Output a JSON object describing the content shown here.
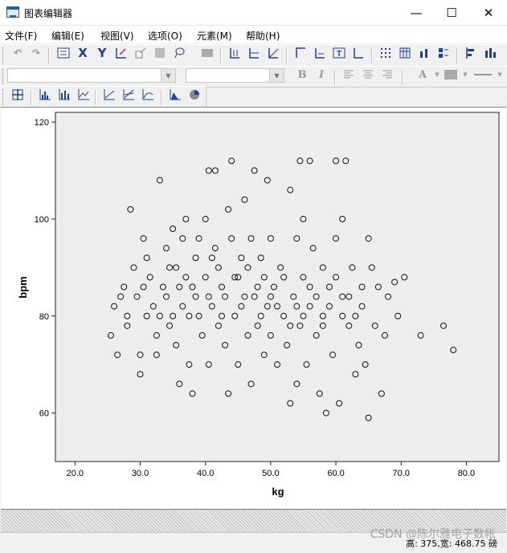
{
  "window": {
    "title": "图表编辑器",
    "minimize": "—",
    "maximize": "☐",
    "close": "✕"
  },
  "menu": [
    "文件(F)",
    "编辑(E)",
    "视图(V)",
    "选项(O)",
    "元素(M)",
    "帮助(H)"
  ],
  "toolbar2": {
    "bold": "B",
    "italic": "I",
    "font_color": "A"
  },
  "status": {
    "text": "高: 375,宽: 468.75 磅"
  },
  "watermark": "CSDN @陈尔雅电子数帐",
  "chart_data": {
    "type": "scatter",
    "xlabel": "kg",
    "ylabel": "bpm",
    "xlim": [
      17,
      85
    ],
    "ylim": [
      50,
      122
    ],
    "xticks": [
      "20.0",
      "30.0",
      "40.0",
      "50.0",
      "60.0",
      "70.0",
      "80.0"
    ],
    "yticks": [
      "60",
      "80",
      "100",
      "120"
    ],
    "background": "#ededed",
    "marker": "open-circle",
    "points": [
      [
        25.5,
        76
      ],
      [
        26.5,
        72
      ],
      [
        26.0,
        82
      ],
      [
        27.0,
        84
      ],
      [
        27.5,
        86
      ],
      [
        28.0,
        80
      ],
      [
        28.0,
        78
      ],
      [
        28.5,
        102
      ],
      [
        29.0,
        90
      ],
      [
        29.5,
        84
      ],
      [
        30.0,
        68
      ],
      [
        30.0,
        72
      ],
      [
        30.5,
        86
      ],
      [
        30.5,
        96
      ],
      [
        31.0,
        80
      ],
      [
        31.0,
        92
      ],
      [
        31.5,
        88
      ],
      [
        32.0,
        82
      ],
      [
        32.5,
        76
      ],
      [
        32.5,
        72
      ],
      [
        33.0,
        108
      ],
      [
        33.5,
        86
      ],
      [
        34.0,
        94
      ],
      [
        34.0,
        84
      ],
      [
        34.5,
        78
      ],
      [
        34.5,
        90
      ],
      [
        35.0,
        98
      ],
      [
        35.0,
        80
      ],
      [
        35.5,
        74
      ],
      [
        36.0,
        86
      ],
      [
        36.0,
        66
      ],
      [
        36.5,
        96
      ],
      [
        37.0,
        100
      ],
      [
        37.0,
        88
      ],
      [
        37.5,
        70
      ],
      [
        37.5,
        80
      ],
      [
        38.0,
        64
      ],
      [
        38.5,
        92
      ],
      [
        38.5,
        84
      ],
      [
        39.0,
        96
      ],
      [
        39.5,
        76
      ],
      [
        40.0,
        100
      ],
      [
        40.0,
        88
      ],
      [
        40.5,
        110
      ],
      [
        40.5,
        70
      ],
      [
        41.0,
        82
      ],
      [
        41.5,
        110
      ],
      [
        41.5,
        94
      ],
      [
        42.0,
        90
      ],
      [
        42.0,
        78
      ],
      [
        42.5,
        86
      ],
      [
        43.0,
        74
      ],
      [
        43.5,
        102
      ],
      [
        43.5,
        64
      ],
      [
        44.0,
        112
      ],
      [
        44.0,
        96
      ],
      [
        44.5,
        80
      ],
      [
        45.0,
        88
      ],
      [
        45.0,
        70
      ],
      [
        45.5,
        92
      ],
      [
        46.0,
        84
      ],
      [
        46.0,
        104
      ],
      [
        46.5,
        76
      ],
      [
        47.0,
        96
      ],
      [
        47.0,
        66
      ],
      [
        47.5,
        110
      ],
      [
        48.0,
        86
      ],
      [
        48.0,
        78
      ],
      [
        48.5,
        92
      ],
      [
        49.0,
        72
      ],
      [
        49.5,
        108
      ],
      [
        49.5,
        82
      ],
      [
        50.0,
        76
      ],
      [
        50.0,
        96
      ],
      [
        50.5,
        86
      ],
      [
        51.0,
        70
      ],
      [
        51.5,
        90
      ],
      [
        52.0,
        80
      ],
      [
        52.5,
        74
      ],
      [
        53.0,
        106
      ],
      [
        53.0,
        62
      ],
      [
        53.5,
        84
      ],
      [
        54.0,
        96
      ],
      [
        54.0,
        66
      ],
      [
        54.5,
        112
      ],
      [
        54.5,
        78
      ],
      [
        55.0,
        100
      ],
      [
        55.0,
        88
      ],
      [
        55.5,
        70
      ],
      [
        56.0,
        112
      ],
      [
        56.0,
        82
      ],
      [
        56.5,
        94
      ],
      [
        57.0,
        76
      ],
      [
        57.5,
        64
      ],
      [
        58.0,
        90
      ],
      [
        58.0,
        80
      ],
      [
        58.5,
        60
      ],
      [
        59.0,
        86
      ],
      [
        59.5,
        72
      ],
      [
        60.0,
        112
      ],
      [
        60.0,
        96
      ],
      [
        60.5,
        62
      ],
      [
        61.0,
        84
      ],
      [
        61.0,
        100
      ],
      [
        61.5,
        112
      ],
      [
        62.0,
        78
      ],
      [
        62.5,
        90
      ],
      [
        63.0,
        68
      ],
      [
        63.5,
        74
      ],
      [
        64.0,
        82
      ],
      [
        64.5,
        70
      ],
      [
        65.0,
        96
      ],
      [
        65.0,
        59
      ],
      [
        65.5,
        90
      ],
      [
        66.0,
        78
      ],
      [
        66.5,
        86
      ],
      [
        67.0,
        64
      ],
      [
        67.5,
        76
      ],
      [
        68.0,
        84
      ],
      [
        69.0,
        87
      ],
      [
        69.5,
        80
      ],
      [
        70.5,
        88
      ],
      [
        73.0,
        76
      ],
      [
        76.5,
        78
      ],
      [
        78.0,
        73
      ],
      [
        33.0,
        80
      ],
      [
        35.5,
        90
      ],
      [
        36.5,
        82
      ],
      [
        38.0,
        86
      ],
      [
        39.0,
        80
      ],
      [
        40.5,
        84
      ],
      [
        41.0,
        92
      ],
      [
        42.5,
        80
      ],
      [
        43.0,
        84
      ],
      [
        44.5,
        88
      ],
      [
        45.5,
        82
      ],
      [
        46.5,
        90
      ],
      [
        47.5,
        84
      ],
      [
        48.5,
        80
      ],
      [
        49.0,
        88
      ],
      [
        50.0,
        84
      ],
      [
        51.0,
        82
      ],
      [
        52.0,
        88
      ],
      [
        53.0,
        78
      ],
      [
        54.0,
        82
      ],
      [
        55.0,
        80
      ],
      [
        56.0,
        86
      ],
      [
        57.0,
        84
      ],
      [
        58.0,
        78
      ],
      [
        59.0,
        82
      ],
      [
        60.0,
        88
      ],
      [
        61.0,
        80
      ],
      [
        62.0,
        84
      ],
      [
        63.0,
        80
      ],
      [
        64.0,
        86
      ]
    ]
  }
}
